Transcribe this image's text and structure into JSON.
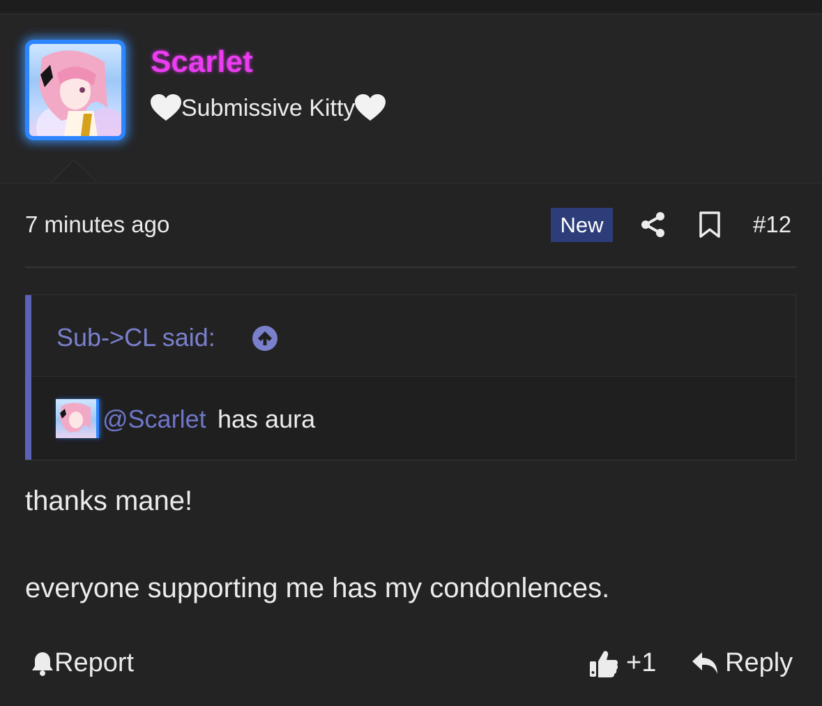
{
  "post": {
    "author": "Scarlet",
    "user_title": "Submissive Kitty",
    "heart_icon": "white-heart",
    "time": "7 minutes ago",
    "new_badge": "New",
    "post_number": "#12",
    "quote": {
      "author_line": "Sub->CL said:",
      "mention": "@Scarlet",
      "text": " has aura"
    },
    "message_lines": [
      "thanks mane!",
      "everyone supporting me has my condonlences."
    ],
    "actions": {
      "report": "Report",
      "like_count": "+1",
      "reply": "Reply"
    }
  },
  "colors": {
    "background": "#232324",
    "username": "#ea3cf0",
    "accent": "#5c62b5",
    "badge": "#2d3d7a",
    "avatar_glow": "#2e86ff"
  }
}
